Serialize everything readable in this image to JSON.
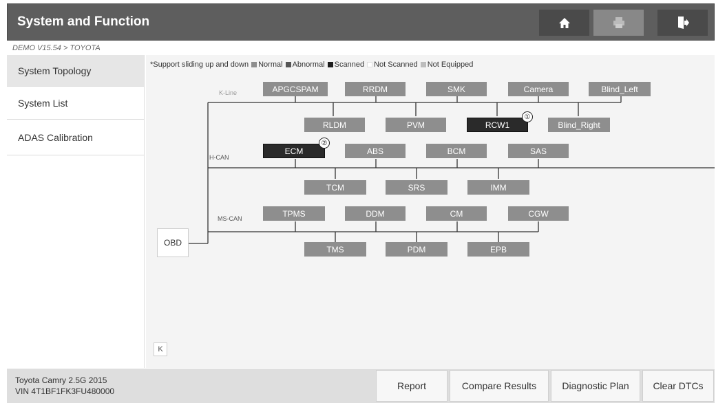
{
  "header": {
    "title": "System and Function",
    "buttons": [
      {
        "name": "home",
        "icon": "home-icon"
      },
      {
        "name": "print",
        "icon": "printer-icon",
        "disabled": true
      },
      {
        "name": "exit",
        "icon": "exit-icon"
      }
    ]
  },
  "breadcrumb": "DEMO V15.54 > TOYOTA",
  "sidebar": {
    "items": [
      {
        "label": "System Topology",
        "active": true
      },
      {
        "label": "System List"
      },
      {
        "label": "ADAS Calibration"
      }
    ]
  },
  "legend": {
    "note": "*Support sliding up and down",
    "items": [
      {
        "label": "Normal",
        "color": "#8e8e8e"
      },
      {
        "label": "Abnormal",
        "color": "#555555"
      },
      {
        "label": "Scanned",
        "color": "#1e1e1e"
      },
      {
        "label": "Not Scanned",
        "color": "#ffffff"
      },
      {
        "label": "Not Equipped",
        "color": "#bdbdbd"
      }
    ]
  },
  "topology": {
    "buses": {
      "kline": "K-Line",
      "hcan": "H-CAN",
      "mscan": "MS-CAN"
    },
    "obd": "OBD",
    "kline_top": [
      "APGCSPAM",
      "RRDM",
      "SMK",
      "Camera",
      "Blind_Left"
    ],
    "kline_bottom": [
      "RLDM",
      "PVM",
      "RCW1",
      "Blind_Right"
    ],
    "hcan_top": [
      "ECM",
      "ABS",
      "BCM",
      "SAS"
    ],
    "hcan_bottom": [
      "TCM",
      "SRS",
      "IMM"
    ],
    "mscan_top": [
      "TPMS",
      "DDM",
      "CM",
      "CGW"
    ],
    "mscan_bottom": [
      "TMS",
      "PDM",
      "EPB"
    ],
    "badges": {
      "rcw1": "①",
      "ecm": "②"
    },
    "collapse": "K"
  },
  "footer": {
    "vehicle_line1": "Toyota Camry 2.5G 2015",
    "vehicle_line2": "VIN 4T1BF1FK3FU480000",
    "buttons": [
      "Report",
      "Compare Results",
      "Diagnostic Plan",
      "Clear DTCs"
    ]
  }
}
